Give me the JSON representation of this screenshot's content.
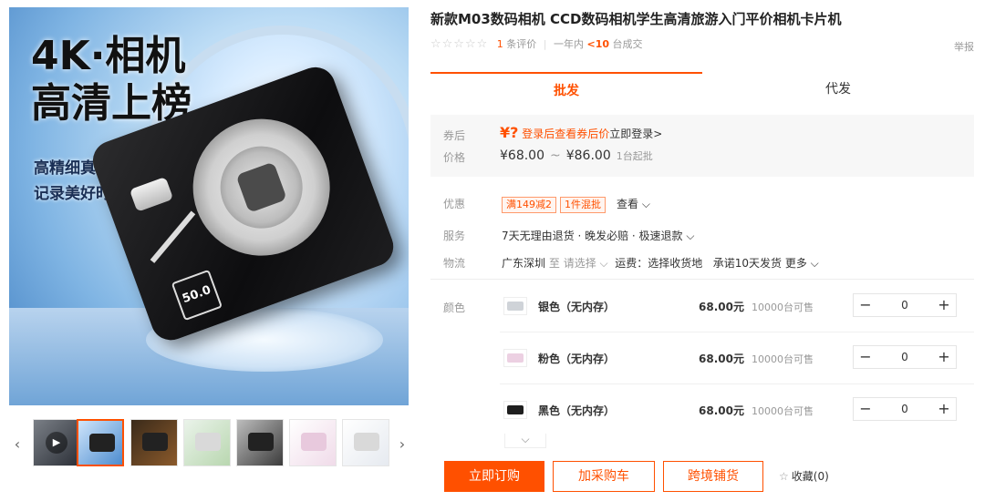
{
  "gallery": {
    "headline_line1": "4K·相机",
    "headline_line2": "高清上榜",
    "subline1": "高精细真实质感",
    "subline2": "记录美好时光",
    "badge_text": "50.0",
    "prev_arrow": "‹",
    "next_arrow": "›",
    "play_icon": "▶"
  },
  "product": {
    "title": "新款M03数码相机 CCD数码相机学生高清旅游入门平价相机卡片机",
    "stars": "☆☆☆☆☆",
    "review_count": "1",
    "review_label": "条评价",
    "sep": "|",
    "period": "一年内",
    "sold_count": "<10",
    "sold_label": "台成交",
    "report": "举报"
  },
  "tabs": [
    {
      "label": "批发"
    },
    {
      "label": "代发"
    }
  ],
  "pricing": {
    "coupon_label": "券后",
    "coupon_symbol": "¥?",
    "coupon_text": "登录后查看券后价",
    "login_text": "立即登录>",
    "price_label": "价格",
    "price_low": "¥68.00",
    "tilde": "~",
    "price_high": "¥86.00",
    "moq": "1台起批"
  },
  "promo": {
    "label": "优惠",
    "tag1": "满149减2",
    "tag2": "1件混批",
    "see": "查看 ⌵"
  },
  "service": {
    "label": "服务",
    "text": "7天无理由退货 · 晚发必赔 · 极速退款 ⌵"
  },
  "logistics": {
    "label": "物流",
    "from": "广东深圳",
    "to": "至",
    "select": "请选择 ⌵",
    "freight": "运费：选择收货地",
    "promise": "承诺10天发货",
    "more": "更多 ⌵"
  },
  "color_label": "颜色",
  "skus": [
    {
      "name": "银色（无内存）",
      "price": "68.00元",
      "stock": "10000台可售",
      "qty": "0"
    },
    {
      "name": "粉色（无内存）",
      "price": "68.00元",
      "stock": "10000台可售",
      "qty": "0"
    },
    {
      "name": "黑色（无内存）",
      "price": "68.00元",
      "stock": "10000台可售",
      "qty": "0"
    }
  ],
  "stepper": {
    "minus": "−",
    "plus": "+"
  },
  "expand": "⌵",
  "actions": {
    "order": "立即订购",
    "cart": "加采购车",
    "cross": "跨境铺货",
    "fav_icon": "☆",
    "fav": "收藏(0)"
  }
}
